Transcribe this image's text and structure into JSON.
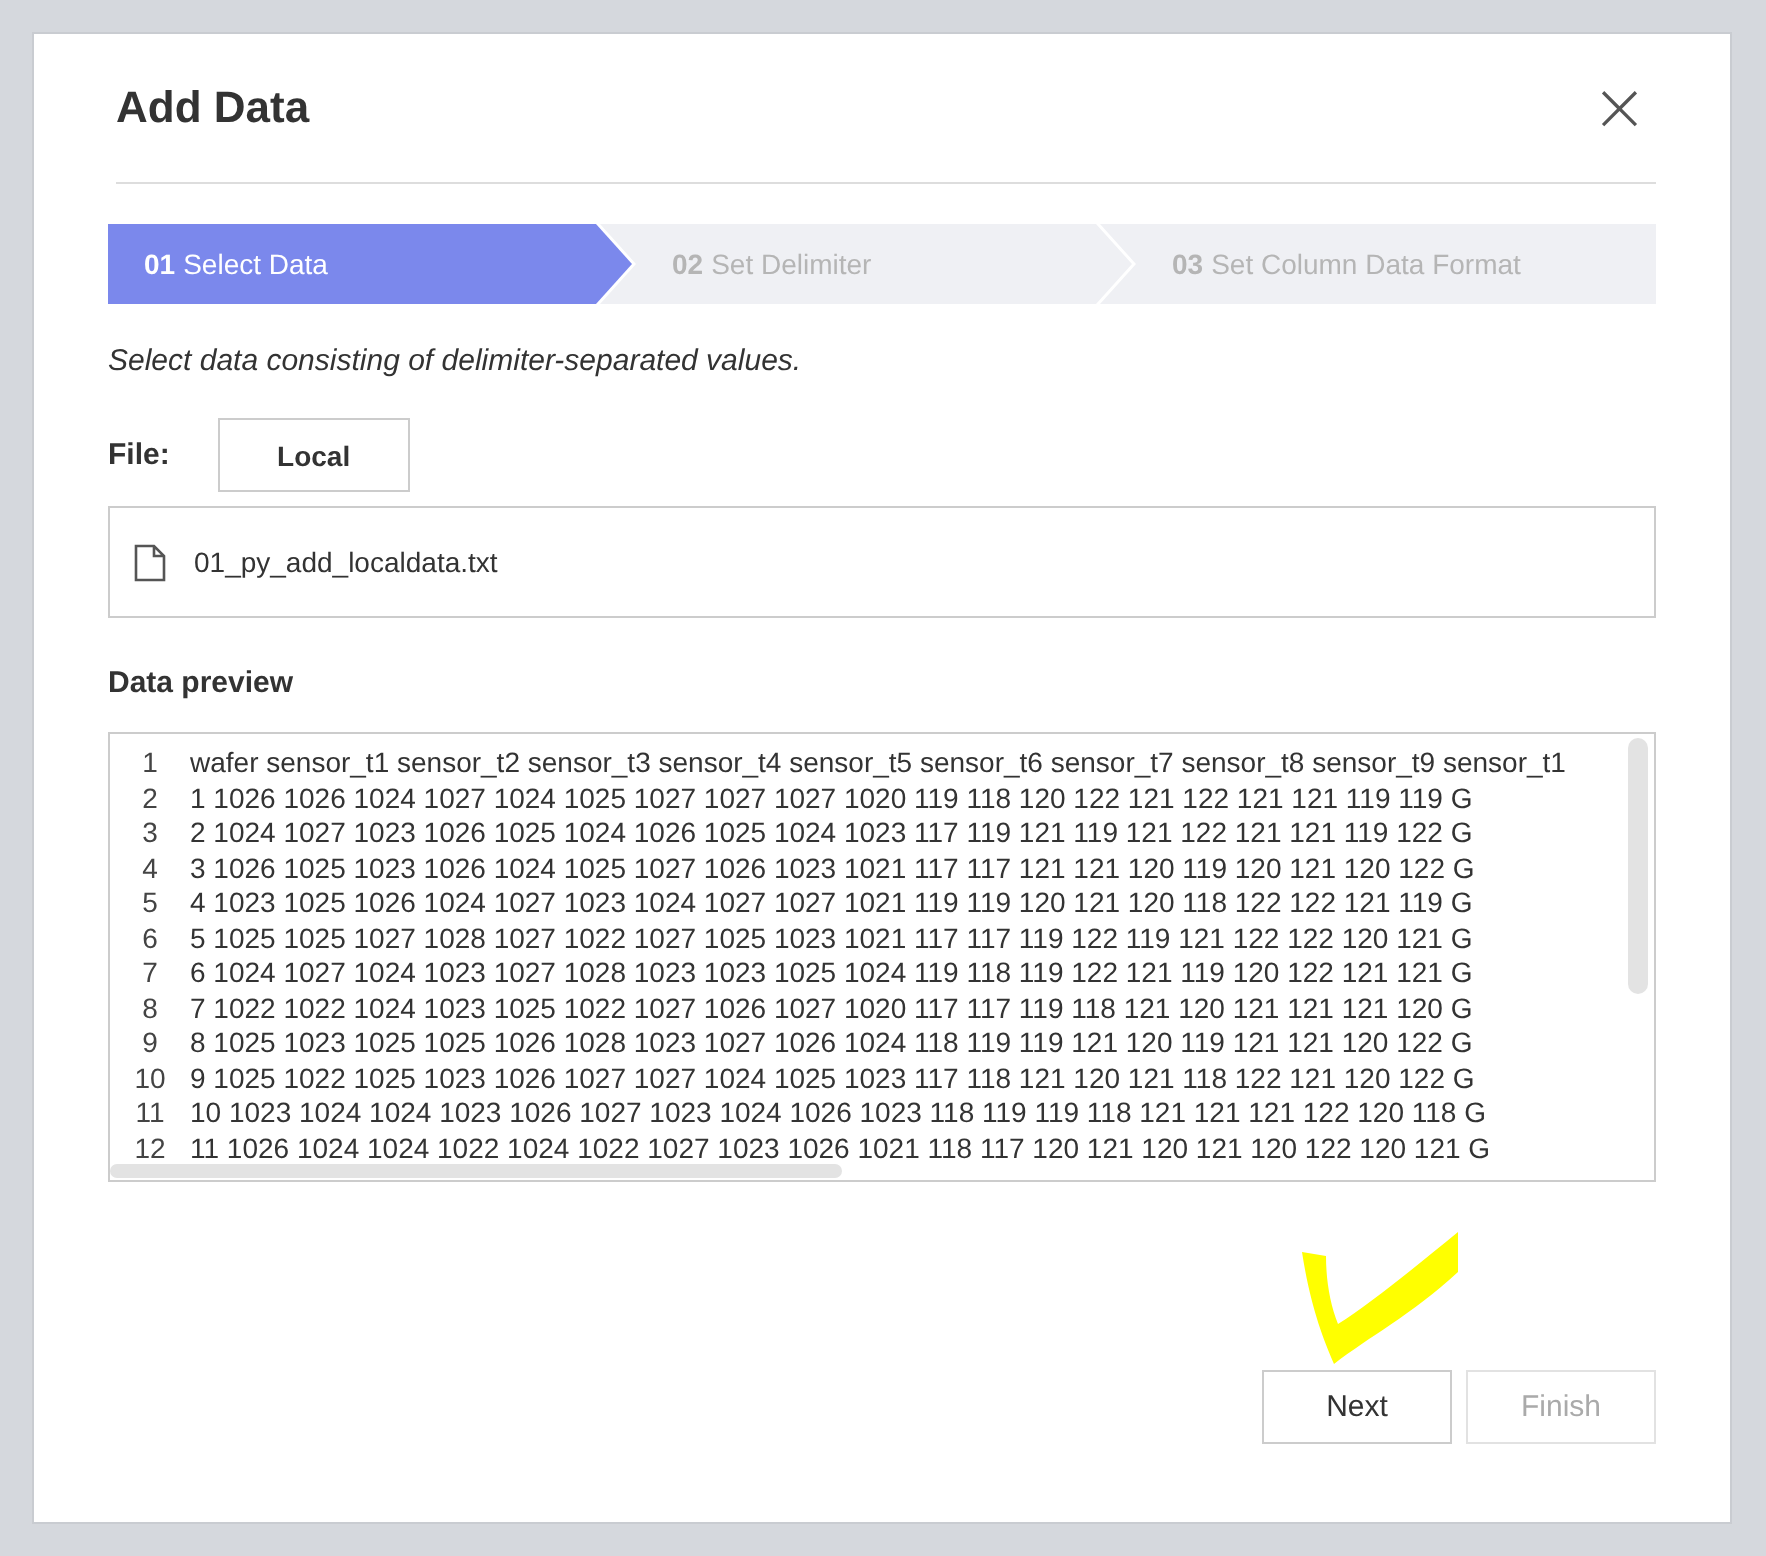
{
  "dialog": {
    "title": "Add Data",
    "close": "×"
  },
  "steps": [
    {
      "number": "01",
      "label": "Select Data",
      "selected": true
    },
    {
      "number": "02",
      "label": "Set Delimiter",
      "selected": false
    },
    {
      "number": "03",
      "label": "Set Column Data Format",
      "selected": false
    }
  ],
  "description": "Select data consisting of delimiter-separated values.",
  "file": {
    "label": "File:",
    "button": "Local",
    "name": "01_py_add_localdata.txt"
  },
  "preview": {
    "title": "Data preview",
    "lines": [
      {
        "number": "1",
        "text": "wafer sensor_t1 sensor_t2 sensor_t3 sensor_t4 sensor_t5 sensor_t6 sensor_t7 sensor_t8 sensor_t9 sensor_t1"
      },
      {
        "number": "2",
        "text": "1 1026 1026 1024 1027 1024 1025 1027 1027 1027 1020 119 118 120 122 121 122 121 121 119 119 G"
      },
      {
        "number": "3",
        "text": "2 1024 1027 1023 1026 1025 1024 1026 1025 1024 1023 117 119 121 119 121 122 121 121 119 122 G"
      },
      {
        "number": "4",
        "text": "3 1026 1025 1023 1026 1024 1025 1027 1026 1023 1021 117 117 121 121 120 119 120 121 120 122 G"
      },
      {
        "number": "5",
        "text": "4 1023 1025 1026 1024 1027 1023 1024 1027 1027 1021 119 119 120 121 120 118 122 122 121 119 G"
      },
      {
        "number": "6",
        "text": "5 1025 1025 1027 1028 1027 1022 1027 1025 1023 1021 117 117 119 122 119 121 122 122 120 121 G"
      },
      {
        "number": "7",
        "text": "6 1024 1027 1024 1023 1027 1028 1023 1023 1025 1024 119 118 119 122 121 119 120 122 121 121 G"
      },
      {
        "number": "8",
        "text": "7 1022 1022 1024 1023 1025 1022 1027 1026 1027 1020 117 117 119 118 121 120 121 121 121 120 G"
      },
      {
        "number": "9",
        "text": "8 1025 1023 1025 1025 1026 1028 1023 1027 1026 1024 118 119 119 121 120 119 121 121 120 122 G"
      },
      {
        "number": "10",
        "text": "9 1025 1022 1025 1023 1026 1027 1027 1024 1025 1023 117 118 121 120 121 118 122 121 120 122 G"
      },
      {
        "number": "11",
        "text": "10 1023 1024 1024 1023 1026 1027 1023 1024 1026 1023 118 119 119 118 121 121 121 122 120 118 G"
      },
      {
        "number": "12",
        "text": "11 1026 1024 1024 1022 1024 1022 1027 1023 1026 1021 118 117 120 121 120 121 120 122 120 121 G"
      }
    ]
  },
  "buttons": [
    {
      "label": "Next",
      "disabled": false
    },
    {
      "label": "Finish",
      "disabled": true
    }
  ]
}
